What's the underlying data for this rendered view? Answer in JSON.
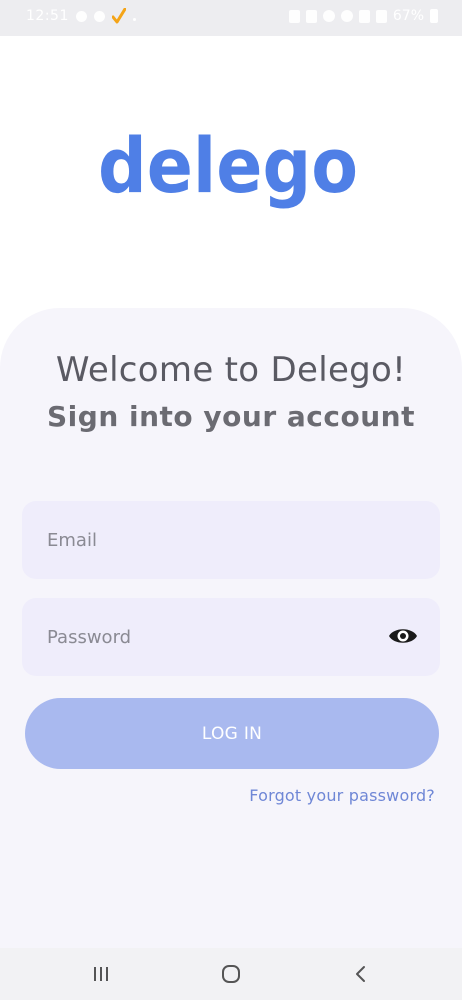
{
  "status_bar": {
    "time": "12:51",
    "battery": "67%"
  },
  "brand": {
    "logo_text": "delego",
    "logo_color": "#4f7fe6"
  },
  "login": {
    "title": "Welcome to Delego!",
    "subtitle": "Sign into your account",
    "email_placeholder": "Email",
    "password_placeholder": "Password",
    "login_button_label": "LOG IN",
    "forgot_password_link": "Forgot your password?"
  },
  "colors": {
    "card_background": "#f6f5fb",
    "field_background": "#efedfb",
    "button_background": "#a9b9ef",
    "link_color": "#6f87d6"
  },
  "icons": {
    "password_toggle": "eye-icon",
    "nav_recents": "recents-icon",
    "nav_home": "home-icon",
    "nav_back": "back-icon"
  }
}
